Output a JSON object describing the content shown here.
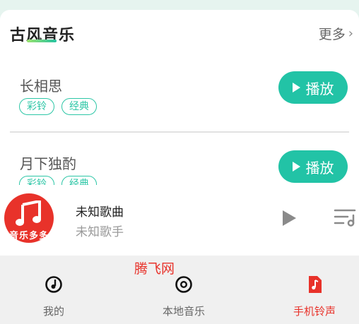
{
  "section": {
    "title": "古风音乐",
    "more_label": "更多"
  },
  "songs": [
    {
      "name": "长相思",
      "tags": [
        "彩铃",
        "经典"
      ],
      "play_label": "播放"
    },
    {
      "name": "月下独酌",
      "tags": [
        "彩铃",
        "经典"
      ],
      "play_label": "播放"
    }
  ],
  "player": {
    "cover_text": "音乐多多",
    "title": "未知歌曲",
    "artist": "未知歌手"
  },
  "watermark": "腾飞网",
  "nav": {
    "items": [
      {
        "label": "我的",
        "icon": "disc-note-icon"
      },
      {
        "label": "本地音乐",
        "icon": "cd-icon"
      },
      {
        "label": "手机铃声",
        "icon": "music-file-icon"
      }
    ],
    "active_index": 2,
    "active_color": "#e8322a"
  },
  "colors": {
    "accent": "#22c3a6",
    "tag": "#2cc6a6",
    "brand_red": "#e8322a"
  }
}
